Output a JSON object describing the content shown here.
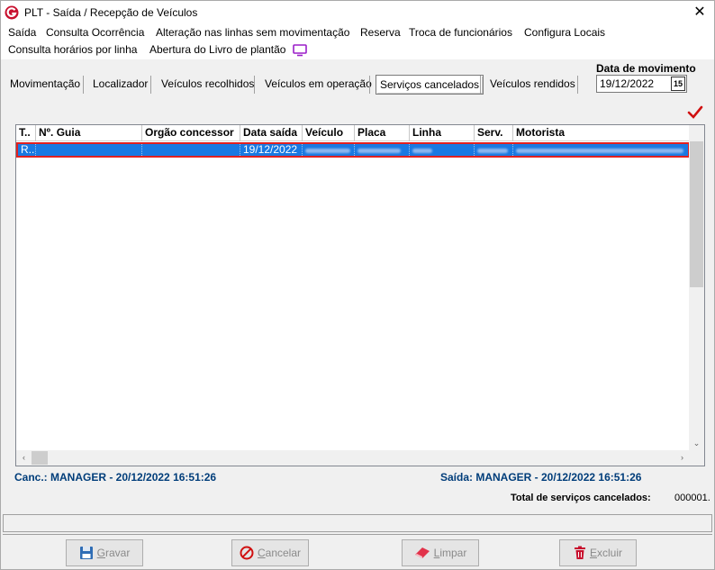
{
  "window": {
    "title": "PLT - Saída / Recepção de Veículos",
    "close": "✕"
  },
  "menu": {
    "row1": [
      "Saída",
      "Consulta Ocorrência",
      "Alteração nas linhas sem movimentação",
      "Reserva",
      "Troca de funcionários",
      "Configura Locais"
    ],
    "row2": [
      "Consulta horários por linha",
      "Abertura do Livro de plantão"
    ]
  },
  "tabs": [
    "Movimentação",
    "Localizador",
    "Veículos recolhidos",
    "Veículos em operação",
    "Serviços cancelados",
    "Veículos rendidos"
  ],
  "active_tab": "Serviços cancelados",
  "date": {
    "label": "Data de movimento",
    "value": "19/12/2022",
    "button": "15"
  },
  "grid": {
    "columns": [
      "T..",
      "Nº. Guia",
      "Orgão concessor",
      "Data saída",
      "Veículo",
      "Placa",
      "Linha",
      "Serv.",
      "Motorista"
    ],
    "rows": [
      {
        "tipo": "R...",
        "guia": "",
        "orgao": "",
        "data_saida": "19/12/2022"
      }
    ]
  },
  "info": {
    "canc": "Canc.: MANAGER - 20/12/2022 16:51:26",
    "saida": "Saída: MANAGER - 20/12/2022 16:51:26",
    "total_label": "Total de serviços cancelados:",
    "total_value": "000001."
  },
  "buttons": {
    "gravar": {
      "first": "G",
      "rest": "ravar"
    },
    "cancelar": {
      "first": "C",
      "rest": "ancelar"
    },
    "limpar": {
      "first": "L",
      "rest": "impar"
    },
    "excluir": {
      "first": "E",
      "rest": "xcluir"
    }
  },
  "colors": {
    "selection": "#1979e2",
    "highlight_border": "#e02020",
    "info_text": "#003d7a"
  }
}
